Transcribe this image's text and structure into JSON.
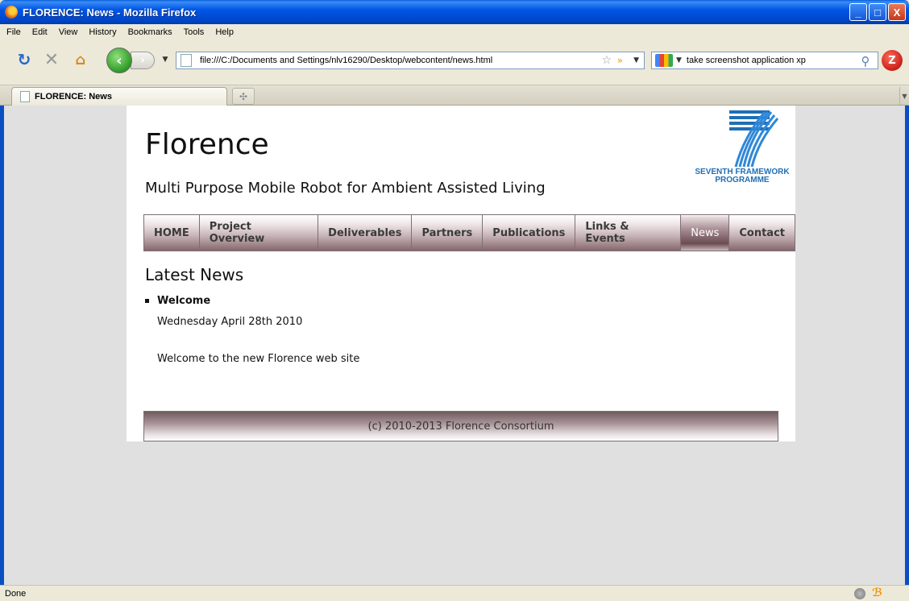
{
  "window": {
    "title": "FLORENCE: News - Mozilla Firefox",
    "minimize": "_",
    "maximize": "□",
    "close": "X"
  },
  "menu": [
    "File",
    "Edit",
    "View",
    "History",
    "Bookmarks",
    "Tools",
    "Help"
  ],
  "toolbar": {
    "url": "file:///C:/Documents and Settings/nlv16290/Desktop/webcontent/news.html",
    "search_query": "take screenshot application xp",
    "zotero_label": "Z"
  },
  "tabs": [
    {
      "title": "FLORENCE: News"
    }
  ],
  "site": {
    "title": "Florence",
    "subtitle": "Multi Purpose Mobile Robot for Ambient Assisted Living",
    "logo_text_line1": "SEVENTH FRAMEWORK",
    "logo_text_line2": "PROGRAMME",
    "logo_brand_color": "#1f6fb5"
  },
  "nav": {
    "items": [
      "HOME",
      "Project Overview",
      "Deliverables",
      "Partners",
      "Publications",
      "Links & Events",
      "News",
      "Contact"
    ],
    "active": "News"
  },
  "news": {
    "heading": "Latest News",
    "items": [
      {
        "title": "Welcome",
        "date": "Wednesday April 28th 2010",
        "body": "Welcome to the new Florence web site"
      }
    ]
  },
  "footer": {
    "text": "(c) 2010-2013 Florence Consortium"
  },
  "status": {
    "text": "Done"
  }
}
